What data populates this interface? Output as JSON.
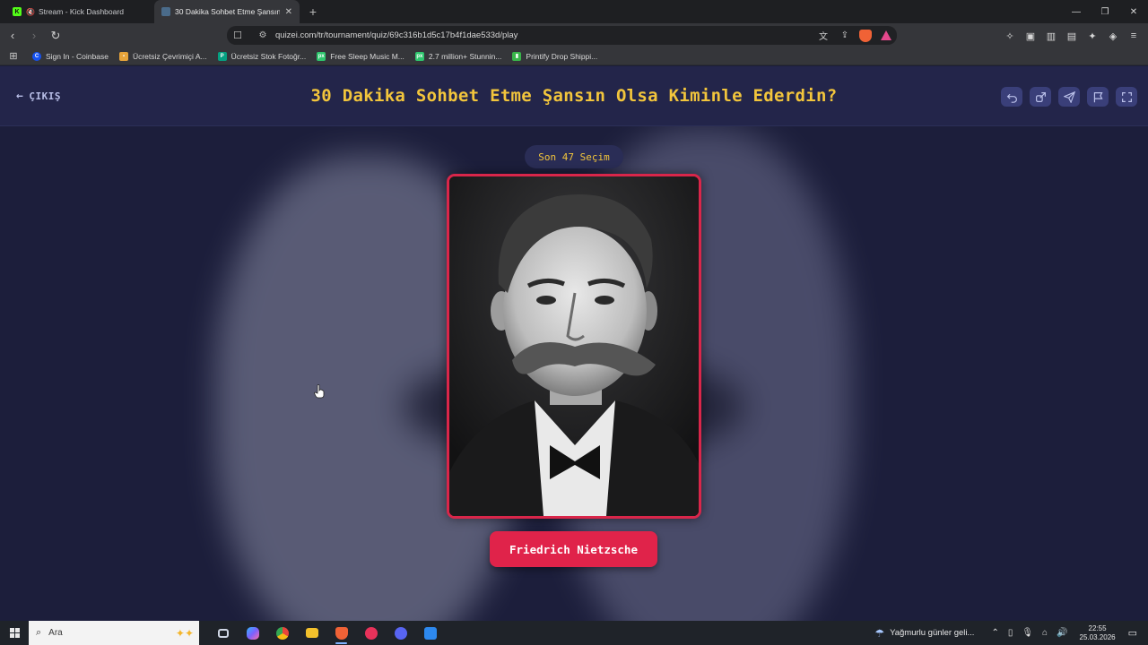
{
  "browser": {
    "tabs": [
      {
        "title": "Stream - Kick Dashboard",
        "favicon": "kick-icon",
        "muted": true,
        "active": false
      },
      {
        "title": "30 Dakika Sohbet Etme Şansın O",
        "favicon": "quizei-icon",
        "active": true
      }
    ],
    "new_tab_label": "+",
    "url": "quizei.com/tr/tournament/quiz/69c316b1d5c17b4f1dae533d/play",
    "bookmarks": [
      {
        "label": "Sign In - Coinbase",
        "icon": "coinbase-icon",
        "color": "#1652f0"
      },
      {
        "label": "Ücretsiz Çevrimiçi A...",
        "icon": "bookmark-icon",
        "color": "#e7a43a"
      },
      {
        "label": "Ücretsiz Stok Fotoğr...",
        "icon": "pexels-icon",
        "color": "#05a081"
      },
      {
        "label": "Free Sleep Music M...",
        "icon": "pixabay-icon",
        "color": "#2ec66d"
      },
      {
        "label": "2.7 million+ Stunnin...",
        "icon": "pixabay-icon",
        "color": "#2ec66d"
      },
      {
        "label": "Printify Drop Shippi...",
        "icon": "printify-icon",
        "color": "#39b54a"
      }
    ]
  },
  "quiz": {
    "exit_label": "ÇIKIŞ",
    "title": "30 Dakika Sohbet Etme Şansın Olsa Kiminle Ederdin?",
    "round_label": "Son 47 Seçim",
    "candidate_name": "Friedrich Nietzsche",
    "header_actions": [
      "undo-icon",
      "share-icon",
      "send-icon",
      "flag-icon",
      "fullscreen-icon"
    ],
    "accent_color": "#f2c53c",
    "card_border_color": "#d9264a",
    "button_color": "#e0234a"
  },
  "taskbar": {
    "search_placeholder": "Ara",
    "weather_text": "Yağmurlu günler geli...",
    "time": "22:55",
    "date": "25.03.2026",
    "apps": [
      {
        "name": "task-view-icon",
        "color": "#cfd6e4"
      },
      {
        "name": "copilot-icon",
        "color": "#7b61ff"
      },
      {
        "name": "chrome-icon",
        "color": "#e8453c"
      },
      {
        "name": "file-explorer-icon",
        "color": "#f3c12c"
      },
      {
        "name": "brave-icon",
        "color": "#f06236",
        "active": true
      },
      {
        "name": "media-player-icon",
        "color": "#e8325a"
      },
      {
        "name": "discord-icon",
        "color": "#5865f2"
      },
      {
        "name": "store-icon",
        "color": "#2d89ef"
      }
    ]
  }
}
